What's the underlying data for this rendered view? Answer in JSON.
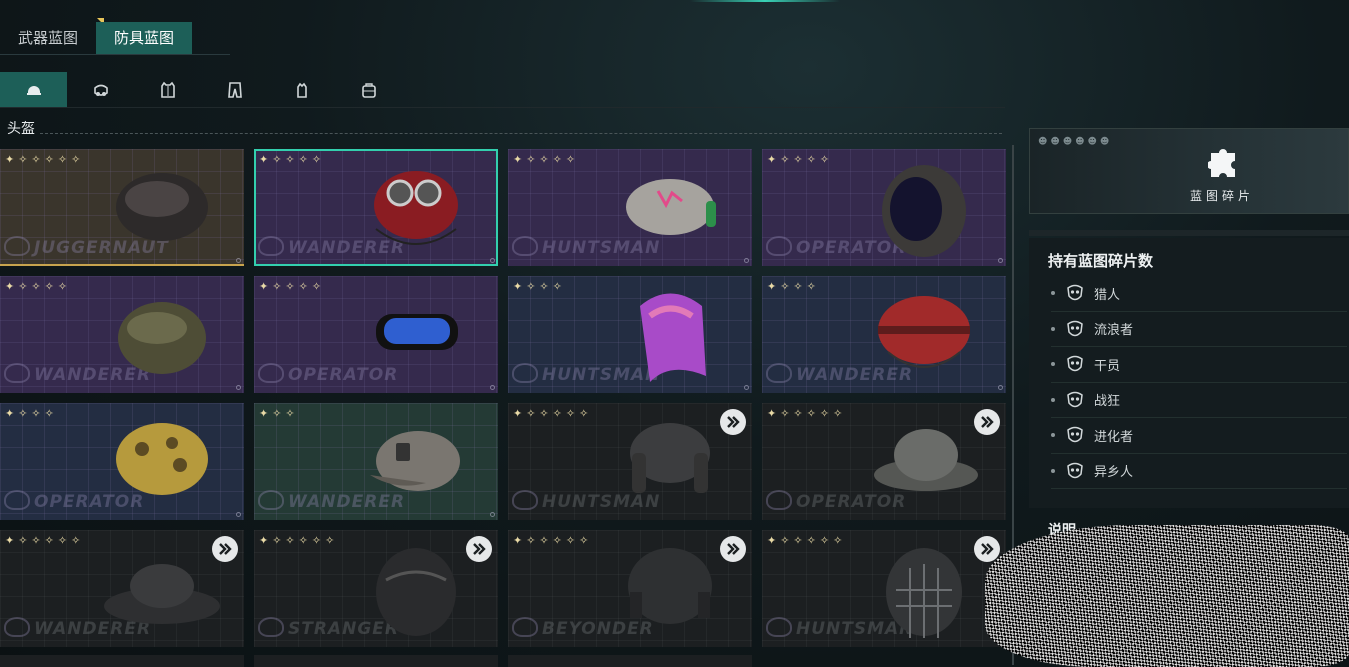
{
  "tabs": [
    {
      "label": "武器蓝图",
      "active": false
    },
    {
      "label": "防具蓝图",
      "active": true
    }
  ],
  "categories": [
    {
      "icon": "helmet-icon",
      "active": true
    },
    {
      "icon": "gas-mask-icon",
      "active": false
    },
    {
      "icon": "armor-vest-icon",
      "active": false
    },
    {
      "icon": "pants-icon",
      "active": false
    },
    {
      "icon": "glove-icon",
      "active": false
    },
    {
      "icon": "backpack-icon",
      "active": false
    }
  ],
  "section_title": "头盔",
  "cards": [
    {
      "brand": "JUGGERNAUT",
      "stars": "✦✧✧✧✧✧",
      "theme": "brown",
      "helmet": "spiked-dark",
      "locked": false,
      "selected": false
    },
    {
      "brand": "WANDERER",
      "stars": "✦✧✧✧✧",
      "theme": "purple",
      "helmet": "red-goggles",
      "locked": false,
      "selected": true
    },
    {
      "brand": "HUNTSMAN",
      "stars": "✦✧✧✧✧",
      "theme": "purple",
      "helmet": "cap-headphones",
      "locked": false,
      "selected": false
    },
    {
      "brand": "OPERATOR",
      "stars": "✦✧✧✧✧",
      "theme": "purple",
      "helmet": "full-face",
      "locked": false,
      "selected": false
    },
    {
      "brand": "WANDERER",
      "stars": "✦✧✧✧✧",
      "theme": "purple",
      "helmet": "olive-cap",
      "locked": false,
      "selected": false
    },
    {
      "brand": "OPERATOR",
      "stars": "✦✧✧✧✧",
      "theme": "purple",
      "helmet": "blue-goggles",
      "locked": false,
      "selected": false
    },
    {
      "brand": "HUNTSMAN",
      "stars": "✦✧✧✧",
      "theme": "blue",
      "helmet": "pink-hood",
      "locked": false,
      "selected": false
    },
    {
      "brand": "WANDERER",
      "stars": "✦✧✧✧",
      "theme": "blue",
      "helmet": "red-helmet",
      "locked": false,
      "selected": false
    },
    {
      "brand": "OPERATOR",
      "stars": "✦✧✧✧",
      "theme": "blue",
      "helmet": "camo-helmet",
      "locked": false,
      "selected": false
    },
    {
      "brand": "WANDERER",
      "stars": "✦✧✧",
      "theme": "green",
      "helmet": "baseball-cap",
      "locked": false,
      "selected": false
    },
    {
      "brand": "HUNTSMAN",
      "stars": "✦✧✧✧✧✧",
      "theme": "dark",
      "helmet": "trapper-hat",
      "locked": true,
      "selected": false
    },
    {
      "brand": "OPERATOR",
      "stars": "✦✧✧✧✧✧",
      "theme": "dark",
      "helmet": "bucket-hat",
      "locked": true,
      "selected": false
    },
    {
      "brand": "WANDERER",
      "stars": "✦✧✧✧✧✧",
      "theme": "dark",
      "helmet": "cowboy-hat",
      "locked": true,
      "selected": false
    },
    {
      "brand": "STRANGER",
      "stars": "✦✧✧✧✧✧",
      "theme": "dark",
      "helmet": "moto-helmet",
      "locked": true,
      "selected": false
    },
    {
      "brand": "BEYONDER",
      "stars": "✦✧✧✧✧✧",
      "theme": "dark",
      "helmet": "tactical-helmet",
      "locked": true,
      "selected": false
    },
    {
      "brand": "HUNTSMAN",
      "stars": "✦✧✧✧✧✧",
      "theme": "dark",
      "helmet": "cage-helmet",
      "locked": true,
      "selected": false
    }
  ],
  "fragment_box": {
    "label": "蓝图碎片"
  },
  "stats": {
    "title": "持有蓝图碎片数",
    "factions": [
      {
        "name": "猎人",
        "icon": "hunter-faction-icon"
      },
      {
        "name": "流浪者",
        "icon": "wanderer-faction-icon"
      },
      {
        "name": "干员",
        "icon": "operator-faction-icon"
      },
      {
        "name": "战狂",
        "icon": "juggernaut-faction-icon"
      },
      {
        "name": "进化者",
        "icon": "evolver-faction-icon"
      },
      {
        "name": "异乡人",
        "icon": "stranger-faction-icon"
      }
    ]
  },
  "description": {
    "title": "说明"
  },
  "colors": {
    "accent": "#1d5f58",
    "highlight": "#33cfae",
    "star": "#e8d9a6"
  }
}
